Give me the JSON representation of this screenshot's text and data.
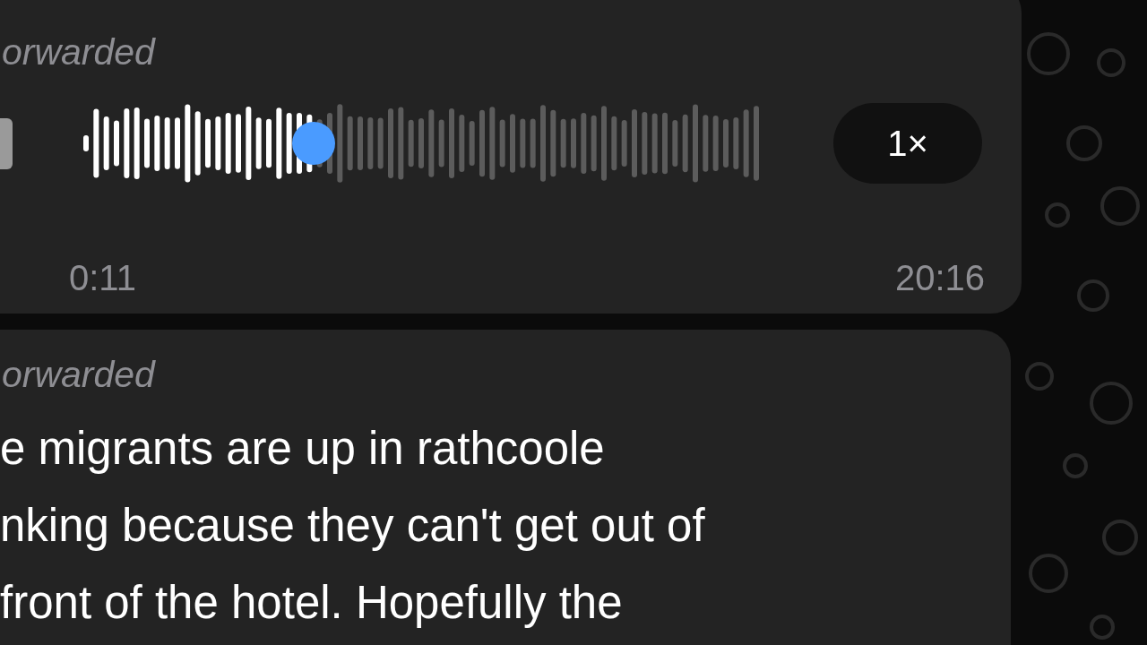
{
  "messages": [
    {
      "kind": "voice",
      "forwarded_label": "orwarded",
      "level": 0.34,
      "elapsed": "0:11",
      "duration": "20:16",
      "speed": "1×"
    },
    {
      "kind": "text",
      "forwarded_label": "orwarded",
      "lines": [
        "e migrants are up in rathcoole",
        "nking because they can't get out of",
        "front of the hotel. Hopefully the"
      ]
    }
  ]
}
